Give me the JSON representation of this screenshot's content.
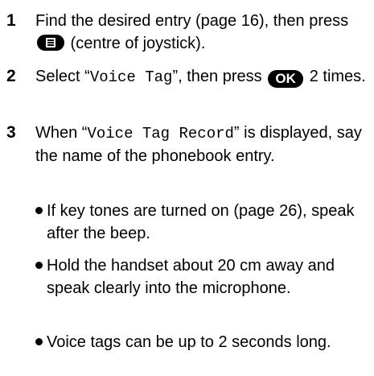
{
  "header_fragment": "",
  "steps": [
    {
      "number": "1",
      "text_before": "Find the desired entry (page 16), then press ",
      "button_icon": "menu-list-button-icon",
      "text_after": " (centre of joystick)."
    },
    {
      "number": "2",
      "text_before": "Select “",
      "mono": "Voice Tag",
      "text_middle": "”, then press ",
      "button_label": "OK",
      "text_after": " 2 times."
    },
    {
      "number": "3",
      "text_before": "When “",
      "mono": "Voice Tag Record",
      "text_after": "” is displayed, say the name of the phonebook entry."
    }
  ],
  "bullets": [
    "If key tones are turned on (page 26), speak after the beep.",
    "Hold the handset about 20 cm away and speak clearly into the microphone.",
    "Voice tags can be up to 2 seconds long."
  ]
}
